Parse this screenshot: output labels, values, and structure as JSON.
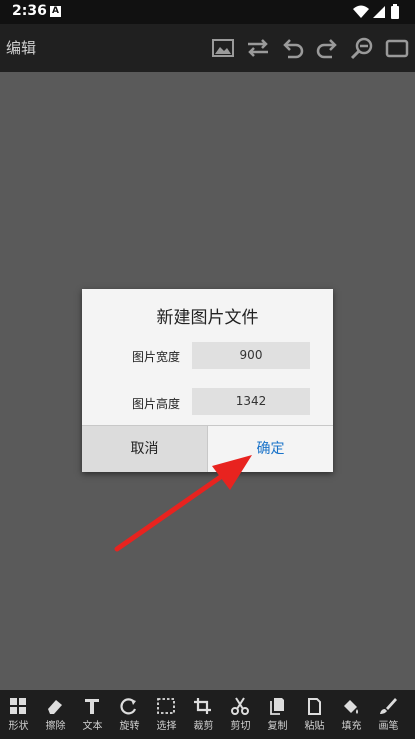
{
  "status_bar": {
    "time": "2:36",
    "notification_icon": "a-app-icon"
  },
  "toolbar": {
    "title": "编辑",
    "icons": [
      "image-icon",
      "swap-icon",
      "undo-icon",
      "redo-icon",
      "zoom-out-icon",
      "fullscreen-icon"
    ]
  },
  "dialog": {
    "title": "新建图片文件",
    "width_label": "图片宽度",
    "width_value": "900",
    "height_label": "图片高度",
    "height_value": "1342",
    "cancel_label": "取消",
    "ok_label": "确定"
  },
  "bottom_bar": {
    "items": [
      {
        "label": "形状",
        "icon": "shapes-icon"
      },
      {
        "label": "擦除",
        "icon": "eraser-icon"
      },
      {
        "label": "文本",
        "icon": "text-icon"
      },
      {
        "label": "旋转",
        "icon": "rotate-icon"
      },
      {
        "label": "选择",
        "icon": "select-icon"
      },
      {
        "label": "裁剪",
        "icon": "crop-icon"
      },
      {
        "label": "剪切",
        "icon": "cut-icon"
      },
      {
        "label": "复制",
        "icon": "copy-icon"
      },
      {
        "label": "粘贴",
        "icon": "paste-icon"
      },
      {
        "label": "填充",
        "icon": "fill-icon"
      },
      {
        "label": "画笔",
        "icon": "brush-icon"
      }
    ]
  },
  "colors": {
    "accent": "#1a73c9",
    "arrow": "#e8231f",
    "toolbar_bg": "#202020",
    "canvas_bg": "#5a5a5a"
  }
}
